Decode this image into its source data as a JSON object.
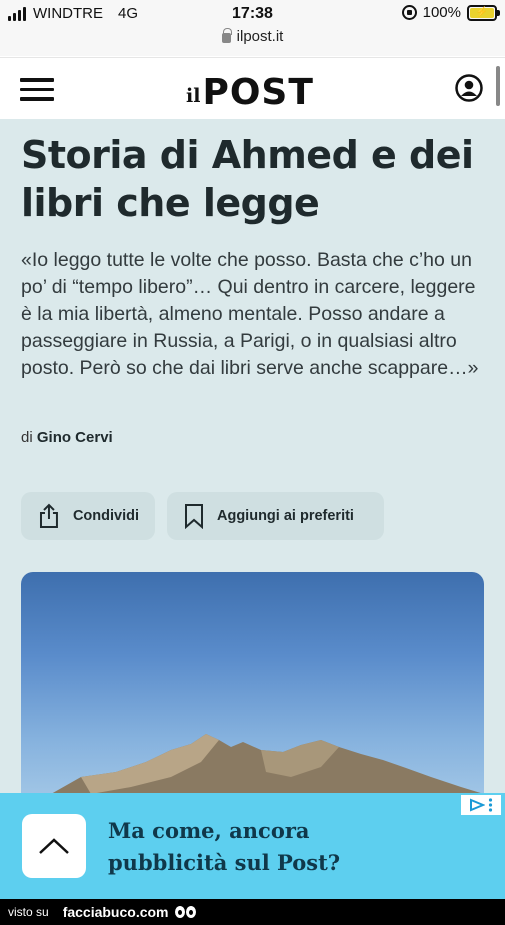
{
  "status_bar": {
    "carrier": "WINDTRE",
    "network": "4G",
    "time": "17:38",
    "battery": "100%",
    "url": "ilpost.it",
    "icons": [
      "signal-icon",
      "rotation-lock-icon",
      "battery-charging-icon",
      "lock-icon"
    ]
  },
  "header": {
    "logo_il": "il",
    "logo_post": "POST",
    "icons": [
      "hamburger-menu-icon",
      "user-account-icon"
    ]
  },
  "article": {
    "title": "Storia di Ahmed e dei libri che legge",
    "lead": "«Io leggo tutte le volte che posso. Basta che c’ho un po’ di “tempo libero”… Qui dentro in carcere, leggere è la mia libertà, almeno mentale. Posso andare a passeggiare in Russia, a Parigi, o in qualsiasi altro posto. Però so che dai libri serve anche scappare…»",
    "byline_prefix": "di",
    "author": "Gino Cervi",
    "actions": {
      "share_label": "Condividi",
      "favorite_label": "Aggiungi ai preferiti"
    },
    "colors": {
      "background": "#dbe9eb",
      "button": "#cfdfe1"
    }
  },
  "ad": {
    "text": "Ma come, ancora pubblicità sul Post?",
    "background": "#5dcfef",
    "icons": [
      "chevron-up-icon",
      "adchoices-icon",
      "more-options-icon"
    ]
  },
  "footer": {
    "visto": "visto su",
    "site": "facciabuco.com"
  }
}
